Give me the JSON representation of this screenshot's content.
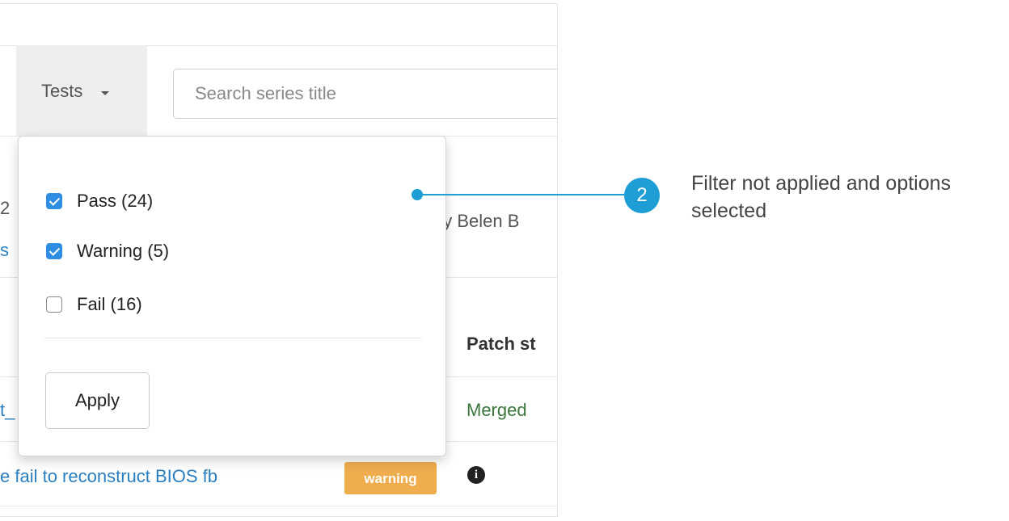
{
  "toolbar": {
    "tests_label": "Tests",
    "search_placeholder": "Search series title"
  },
  "background": {
    "partial_digit": "2",
    "partial_link_s": "s",
    "partial_author": "by Belen B",
    "patch_status_header": "Patch st",
    "partial_link_t": "t_",
    "row_status": "Merged",
    "row_title": "e fail to reconstruct BIOS fb",
    "row_badge": "warning"
  },
  "dropdown": {
    "options": [
      {
        "label": "Pass (24)",
        "checked": true
      },
      {
        "label": "Warning (5)",
        "checked": true
      },
      {
        "label": "Fail (16)",
        "checked": false
      }
    ],
    "apply_label": "Apply"
  },
  "callout": {
    "number": "2",
    "text": "Filter not applied and options selected"
  },
  "colors": {
    "accent": "#1e9ed5",
    "checkbox": "#2d8ee3",
    "warning_badge": "#f0ad4e",
    "merged": "#3c763d",
    "link": "#2a7fc0"
  }
}
